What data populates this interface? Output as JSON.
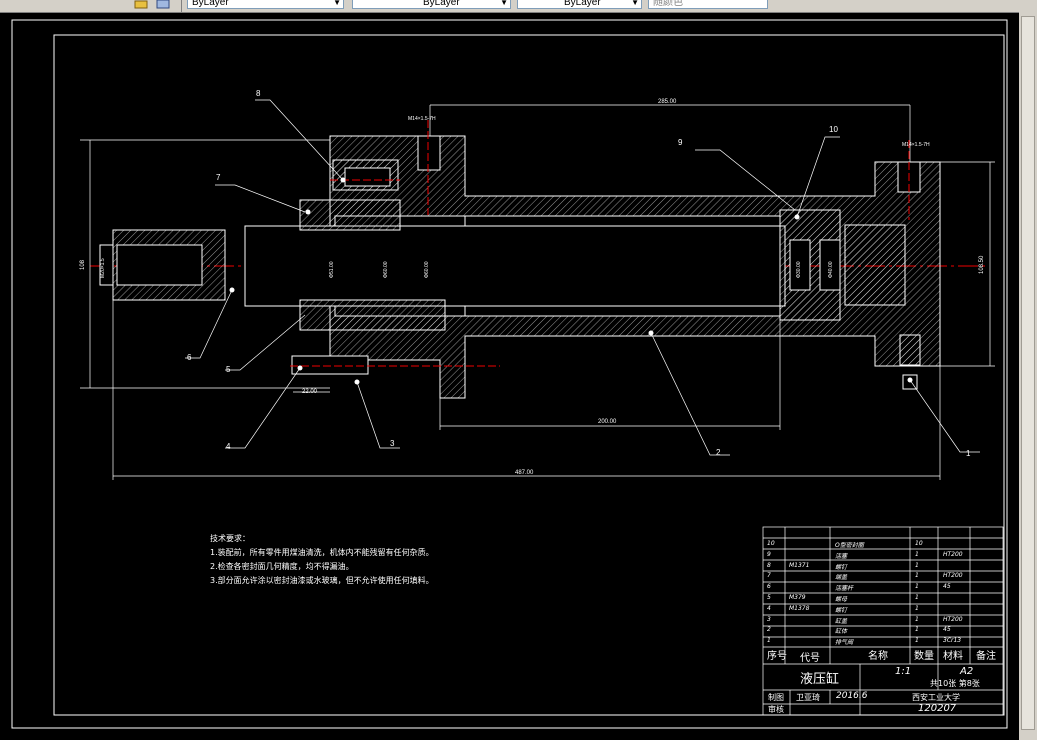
{
  "toolbar": {
    "layer_dropdown_1": "ByLayer",
    "layer_dropdown_2": "ByLayer",
    "layer_dropdown_3": "ByLayer",
    "color_dropdown": "随颜色"
  },
  "drawing": {
    "dimensions": {
      "overall_length": "487.00",
      "upper_length": "285.00",
      "lower_length": "200.00",
      "port_offset": "22.00",
      "thread_left": "M14×1.5-7H",
      "thread_right": "M14×1.5-7H",
      "height_left": "108",
      "height_right": "108.50",
      "rod_dia": "Φ51.00",
      "bore_1": "Φ60.00",
      "bore_2": "Φ60.00",
      "piston_1": "Φ30.00",
      "piston_2": "Φ40.00",
      "rod_end": "M20×1.5"
    },
    "balloons": [
      "1",
      "2",
      "3",
      "4",
      "5",
      "6",
      "7",
      "8",
      "9",
      "10"
    ]
  },
  "tech_requirements": {
    "title": "技术要求：",
    "items": [
      "1.装配前，所有零件用煤油清洗，机体内不能残留有任何杂质。",
      "2.检查各密封面几何精度，均不得漏油。",
      "3.部分面允许涂以密封油漆或水玻璃，但不允许使用任何填料。"
    ]
  },
  "title_block": {
    "bom": [
      {
        "no": "10",
        "code": "",
        "name": "O型密封圈",
        "qty": "10",
        "material": "",
        "note": ""
      },
      {
        "no": "9",
        "code": "",
        "name": "活塞",
        "qty": "1",
        "material": "HT200",
        "note": ""
      },
      {
        "no": "8",
        "code": "M1371",
        "name": "螺钉",
        "qty": "1",
        "material": "",
        "note": ""
      },
      {
        "no": "7",
        "code": "",
        "name": "端盖",
        "qty": "1",
        "material": "HT200",
        "note": ""
      },
      {
        "no": "6",
        "code": "",
        "name": "活塞杆",
        "qty": "1",
        "material": "45",
        "note": ""
      },
      {
        "no": "5",
        "code": "M379",
        "name": "螺母",
        "qty": "1",
        "material": "",
        "note": ""
      },
      {
        "no": "4",
        "code": "M1378",
        "name": "螺钉",
        "qty": "1",
        "material": "",
        "note": ""
      },
      {
        "no": "3",
        "code": "",
        "name": "缸盖",
        "qty": "1",
        "material": "HT200",
        "note": ""
      },
      {
        "no": "2",
        "code": "",
        "name": "缸体",
        "qty": "1",
        "material": "45",
        "note": ""
      },
      {
        "no": "1",
        "code": "",
        "name": "排气阀",
        "qty": "1",
        "material": "3Cr13",
        "note": ""
      }
    ],
    "headers": {
      "no": "序号",
      "code": "代号",
      "name": "名称",
      "qty": "数量",
      "material": "材料",
      "note": "备注"
    },
    "part_name": "液压缸",
    "scale": "1:1",
    "sheet_size": "A2",
    "sheets": "共10张 第8张",
    "drawn_label": "制图",
    "drawn_by": "卫亚琦",
    "date": "2016.6",
    "school": "西安工业大学",
    "checked_label": "审核",
    "student_id": "120207"
  }
}
